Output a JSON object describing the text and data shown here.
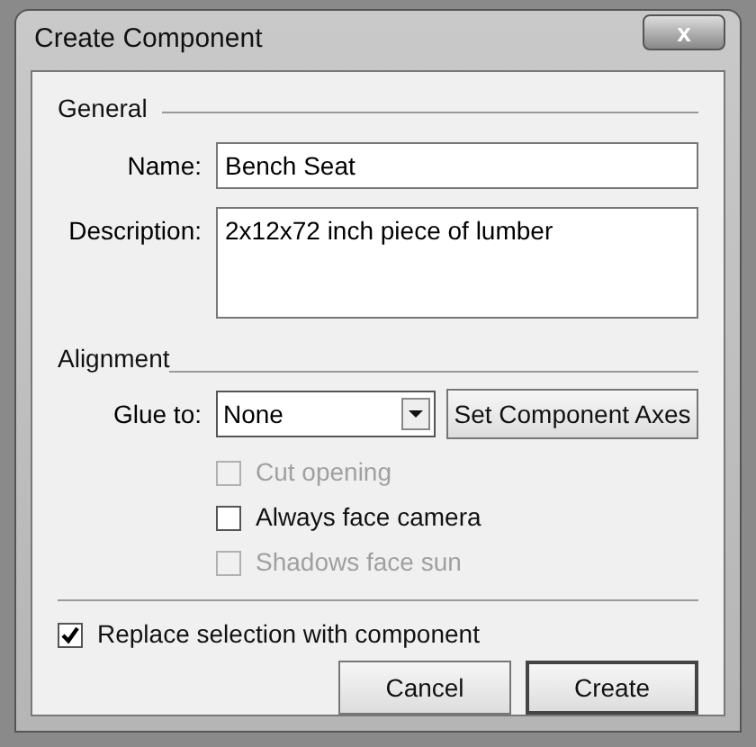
{
  "window": {
    "title": "Create Component",
    "close_label": "x"
  },
  "general": {
    "title": "General",
    "name_label": "Name:",
    "name_value": "Bench Seat",
    "description_label": "Description:",
    "description_value": "2x12x72 inch piece of lumber"
  },
  "alignment": {
    "title": "Alignment",
    "glue_label": "Glue to:",
    "glue_value": "None",
    "axes_button": "Set Component Axes",
    "options": [
      {
        "label": "Cut opening",
        "checked": false,
        "disabled": true
      },
      {
        "label": "Always face camera",
        "checked": false,
        "disabled": false
      },
      {
        "label": "Shadows face sun",
        "checked": false,
        "disabled": true
      }
    ]
  },
  "replace": {
    "label": "Replace selection with component",
    "checked": true,
    "disabled": false
  },
  "buttons": [
    {
      "label": "Cancel",
      "default": false
    },
    {
      "label": "Create",
      "default": true
    }
  ]
}
